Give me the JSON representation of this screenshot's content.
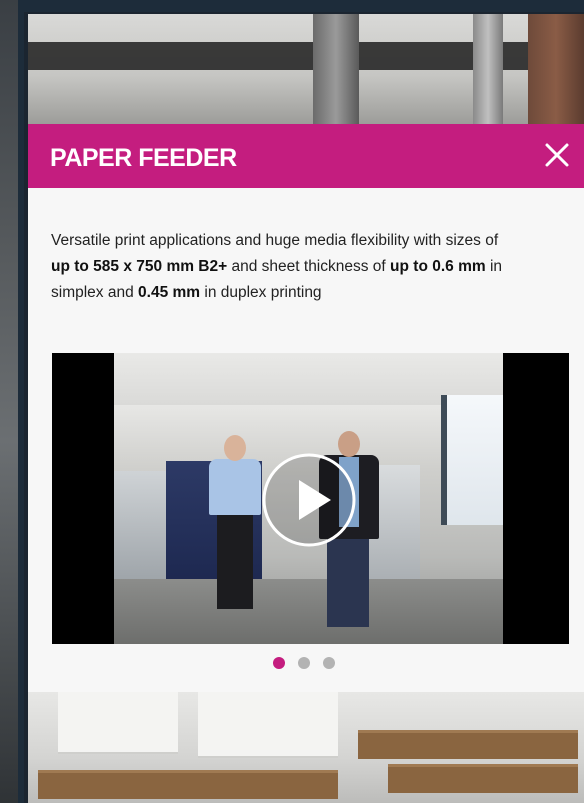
{
  "popup": {
    "title": "PAPER FEEDER",
    "close_icon": "close-icon",
    "description_parts": [
      {
        "text": "Versatile print applications and huge media flexibility with sizes of ",
        "bold": false
      },
      {
        "text": "up to 585 x 750 mm B2+",
        "bold": true
      },
      {
        "text": " and sheet thickness of ",
        "bold": false
      },
      {
        "text": "up to 0.6 mm",
        "bold": true
      },
      {
        "text": " in simplex and ",
        "bold": false
      },
      {
        "text": "0.45 mm",
        "bold": true
      },
      {
        "text": " in duplex printing",
        "bold": false
      }
    ],
    "video": {
      "play_icon": "play-icon"
    },
    "carousel": {
      "total": 3,
      "active_index": 0,
      "active_color": "#c41d7f",
      "inactive_color": "#b3b3b3"
    }
  },
  "colors": {
    "accent": "#c41d7f",
    "header_text": "#ffffff",
    "body_bg": "#f7f7f7"
  }
}
